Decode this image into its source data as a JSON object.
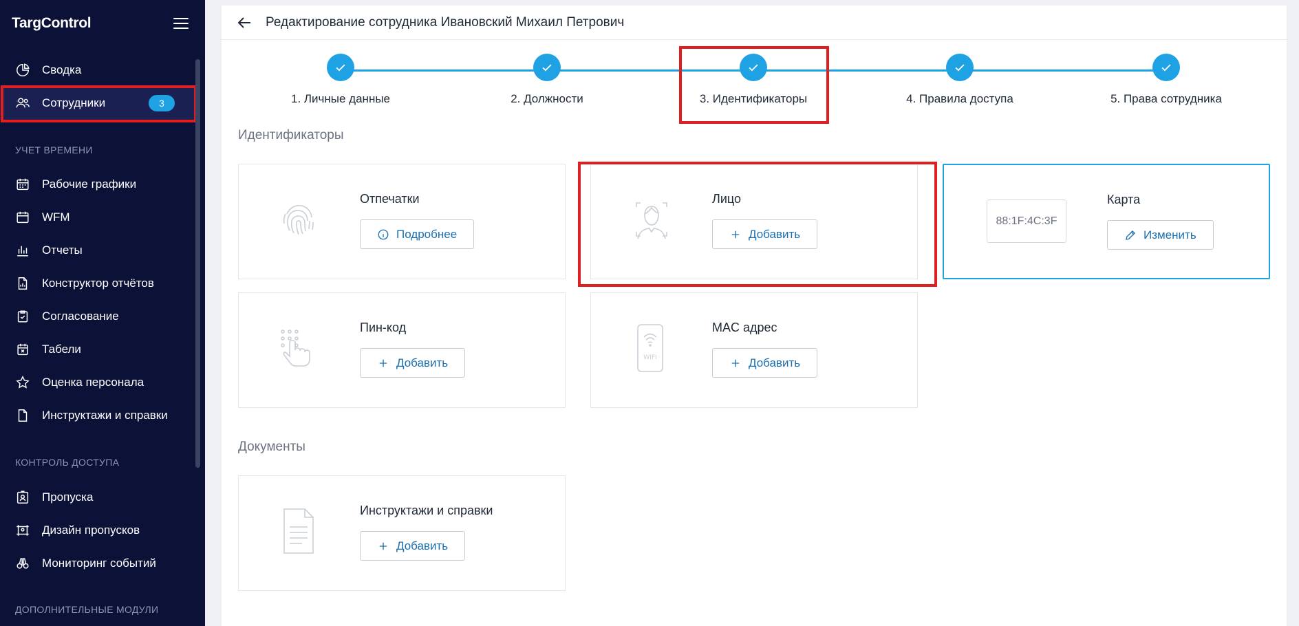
{
  "app": {
    "brand": "TargControl"
  },
  "sidebar": {
    "top_items": [
      {
        "label": "Сводка",
        "icon": "pie-chart-icon"
      },
      {
        "label": "Сотрудники",
        "icon": "users-icon",
        "badge": "3",
        "active": true
      }
    ],
    "sections": [
      {
        "title": "УЧЕТ ВРЕМЕНИ",
        "items": [
          {
            "label": "Рабочие графики",
            "icon": "calendar-grid-icon"
          },
          {
            "label": "WFM",
            "icon": "calendar-icon"
          },
          {
            "label": "Отчеты",
            "icon": "bar-chart-icon"
          },
          {
            "label": "Конструктор отчётов",
            "icon": "report-builder-icon"
          },
          {
            "label": "Согласование",
            "icon": "clipboard-check-icon"
          },
          {
            "label": "Табели",
            "icon": "calendar-x-icon"
          },
          {
            "label": "Оценка персонала",
            "icon": "star-icon"
          },
          {
            "label": "Инструктажи и справки",
            "icon": "document-icon"
          }
        ]
      },
      {
        "title": "КОНТРОЛЬ ДОСТУПА",
        "items": [
          {
            "label": "Пропуска",
            "icon": "badge-icon"
          },
          {
            "label": "Дизайн пропусков",
            "icon": "badge-design-icon"
          },
          {
            "label": "Мониторинг событий",
            "icon": "binoculars-icon"
          }
        ]
      },
      {
        "title": "ДОПОЛНИТЕЛЬНЫЕ МОДУЛИ",
        "items": []
      }
    ]
  },
  "header": {
    "title": "Редактирование сотрудника Ивановский Михаил Петрович"
  },
  "stepper": {
    "steps": [
      {
        "label": "1. Личные данные",
        "done": true
      },
      {
        "label": "2. Должности",
        "done": true
      },
      {
        "label": "3. Идентификаторы",
        "done": true
      },
      {
        "label": "4. Правила доступа",
        "done": true
      },
      {
        "label": "5. Права сотрудника",
        "done": true
      }
    ]
  },
  "identifiers": {
    "section_title": "Идентификаторы",
    "cards": [
      {
        "title": "Отпечатки",
        "icon": "fingerprint-icon",
        "button": "Подробнее",
        "button_icon": "info-icon"
      },
      {
        "title": "Лицо",
        "icon": "face-scan-icon",
        "button": "Добавить",
        "button_icon": "plus-icon"
      },
      {
        "title": "Карта",
        "value": "88:1F:4C:3F",
        "button": "Изменить",
        "button_icon": "pencil-icon",
        "selected": true
      },
      {
        "title": "Пин-код",
        "icon": "keypad-touch-icon",
        "button": "Добавить",
        "button_icon": "plus-icon"
      },
      {
        "title": "MAC адрес",
        "icon": "phone-wifi-icon",
        "button": "Добавить",
        "button_icon": "plus-icon",
        "icon_text": "WIFI"
      }
    ]
  },
  "documents": {
    "section_title": "Документы",
    "cards": [
      {
        "title": "Инструктажи и справки",
        "icon": "document-lines-icon",
        "button": "Добавить",
        "button_icon": "plus-icon"
      }
    ]
  },
  "colors": {
    "accent": "#1fa2e3",
    "sidebar_bg": "#0b1137",
    "highlight": "#e02020",
    "link": "#1a6fb0"
  }
}
